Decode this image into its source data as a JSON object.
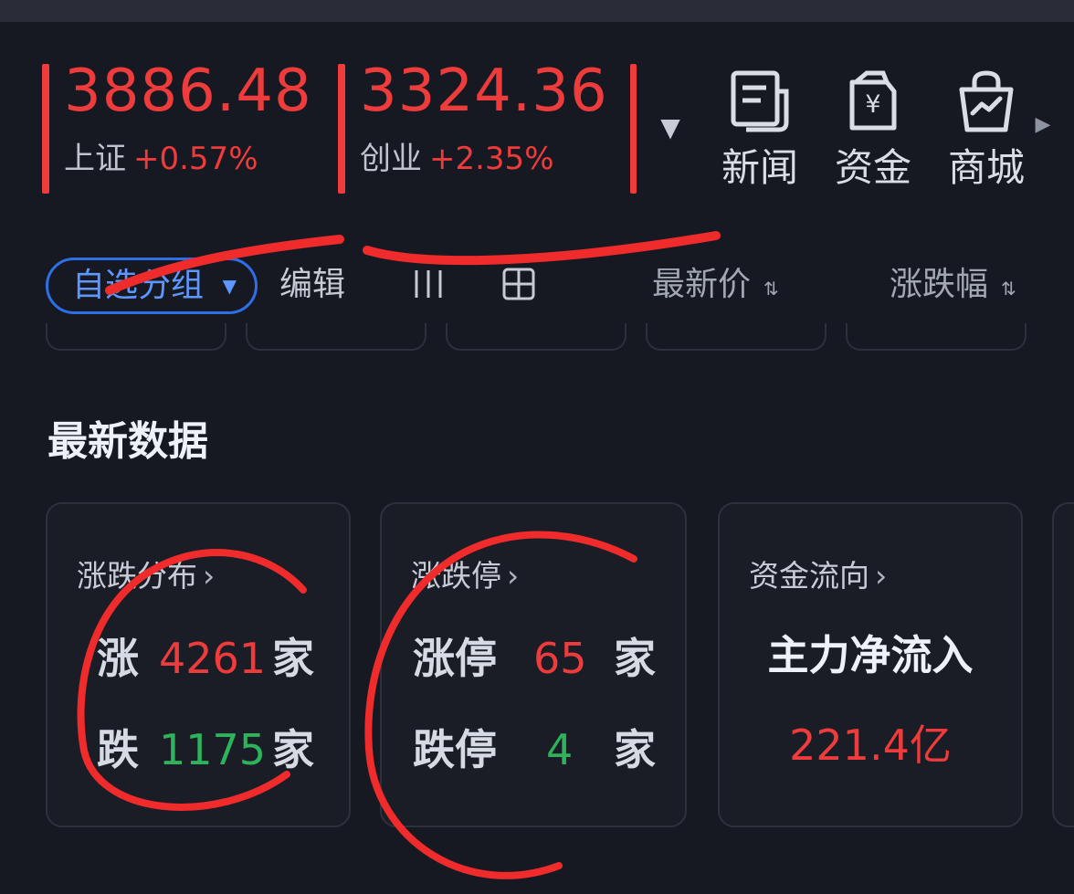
{
  "indices": [
    {
      "value": "3886.48",
      "name": "上证",
      "change": "+0.57%"
    },
    {
      "value": "3324.36",
      "name": "创业",
      "change": "+2.35%"
    }
  ],
  "quick_links": {
    "news": {
      "label": "新闻",
      "icon": "news-icon"
    },
    "funds": {
      "label": "资金",
      "icon": "yen-wallet-icon"
    },
    "mall": {
      "label": "商城",
      "icon": "shopping-bag-icon"
    }
  },
  "toolbar": {
    "group_label": "自选分组",
    "edit_label": "编辑",
    "latest_price_label": "最新价",
    "change_pct_label": "涨跌幅",
    "sort_icon": "sort-icon",
    "column_view_icon": "column-view-icon",
    "grid_view_icon": "grid-view-icon"
  },
  "latest_data": {
    "title": "最新数据",
    "cards": {
      "distribution": {
        "title": "涨跌分布",
        "up_label": "涨",
        "up_value": "4261",
        "down_label": "跌",
        "down_value": "1175",
        "unit": "家"
      },
      "limit": {
        "title": "涨跌停",
        "up_label": "涨停",
        "up_value": "65",
        "down_label": "跌停",
        "down_value": "4",
        "unit": "家"
      },
      "flow": {
        "title": "资金流向",
        "label": "主力净流入",
        "value": "221.4亿"
      }
    }
  },
  "colors": {
    "background": "#171922",
    "rise": "#ee3b3b",
    "fall": "#2eb35c",
    "accent": "#2e6fe8",
    "text": "#e6e9f0",
    "annotation": "#ef2b2b"
  }
}
